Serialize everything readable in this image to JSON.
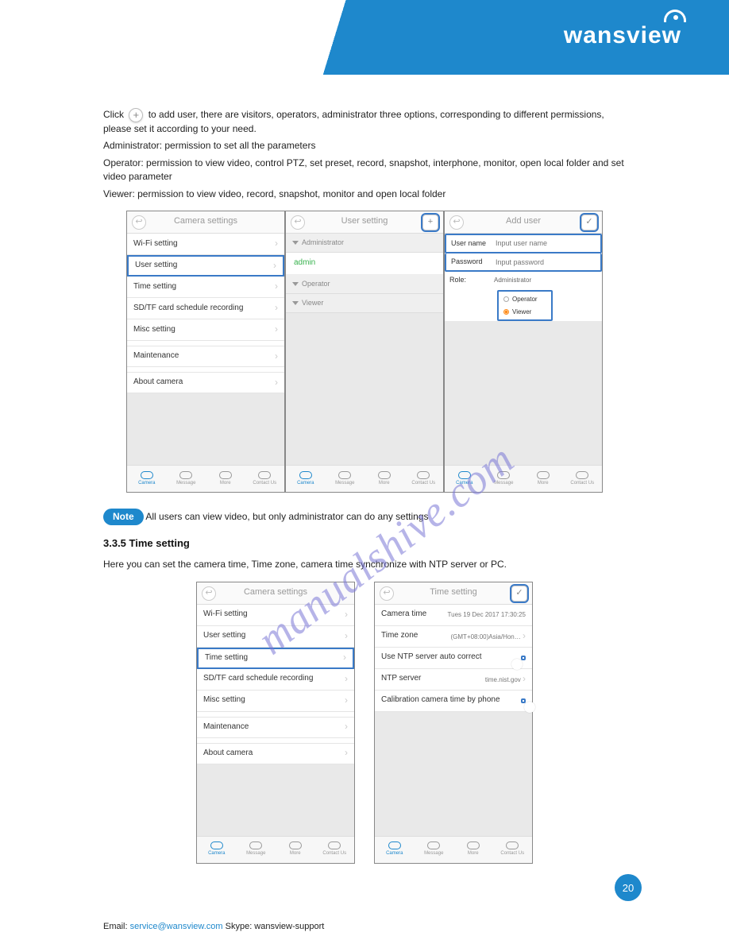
{
  "brand": "wansview",
  "watermark": "manualshive.com",
  "page_number": "20",
  "footer_prefix": "Email: ",
  "footer_email_link": "service@wansview.com",
  "footer_suffix": "     Skype: wansview-support",
  "section": {
    "para1_before_icon": "Click",
    "para1_after_icon": "to add user, there are visitors, operators, administrator three options, corresponding to different permissions, please set it according to your need.",
    "perm_admin": "Administrator: permission to set all the parameters",
    "perm_operator": "Operator: permission to view video, control PTZ, set preset, record, snapshot, interphone, monitor, open local folder and set video parameter",
    "perm_viewer": "Viewer: permission to view video, record, snapshot, monitor and open local folder",
    "heading_time": "3.3.5 Time setting",
    "time_text": "Here you can set the camera time, Time zone, camera time synchronize with NTP server or PC."
  },
  "note_label": "Note",
  "note_text": " All users can view video, but only administrator can do any settings",
  "screens": {
    "camera_settings": {
      "title": "Camera settings",
      "items": [
        "Wi-Fi setting",
        "User setting",
        "Time setting",
        "SD/TF card schedule recording",
        "Misc setting",
        "Maintenance",
        "About camera"
      ]
    },
    "user_setting": {
      "title": "User setting",
      "groups": [
        "Administrator",
        "Operator",
        "Viewer"
      ],
      "admin_user": "admin"
    },
    "add_user": {
      "title": "Add user",
      "username_label": "User name",
      "username_placeholder": "Input user name",
      "password_label": "Password",
      "password_placeholder": "Input password",
      "role_label": "Role:",
      "roles": [
        "Administrator",
        "Operator",
        "Viewer"
      ]
    },
    "time_setting": {
      "title": "Time setting",
      "rows": {
        "camera_time": {
          "label": "Camera time",
          "value": "Tues 19 Dec 2017  17:30:25"
        },
        "time_zone": {
          "label": "Time zone",
          "value": "(GMT+08:00)Asia/Hon…"
        },
        "ntp_auto": {
          "label": "Use NTP server auto correct"
        },
        "ntp_server": {
          "label": "NTP server",
          "value": "time.nist.gov"
        },
        "cal_phone": {
          "label": "Calibration camera time by phone"
        }
      }
    },
    "tabs": [
      "Camera",
      "Message",
      "More",
      "Contact Us"
    ]
  }
}
